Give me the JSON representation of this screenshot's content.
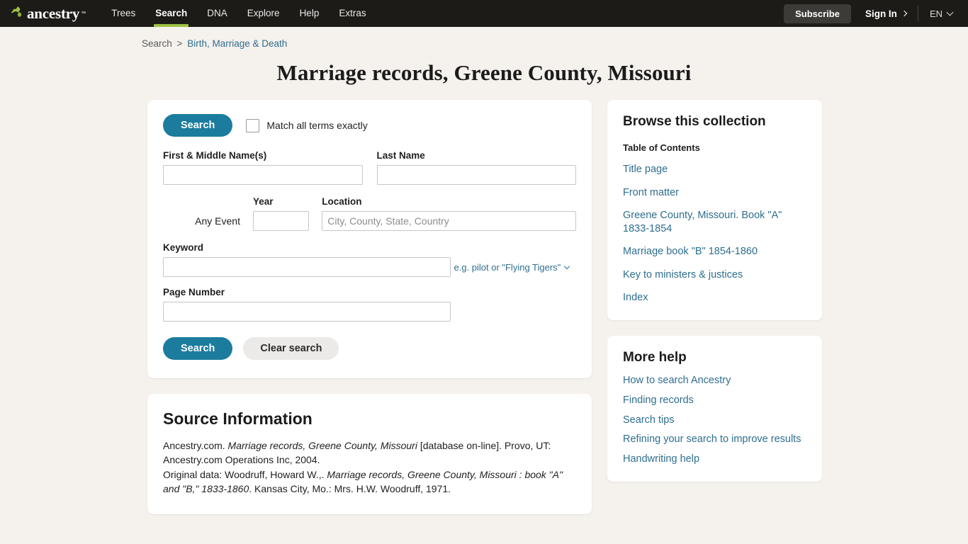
{
  "navbar": {
    "logo_text": "ancestry",
    "logo_tm": "™",
    "links": [
      {
        "label": "Trees",
        "active": false
      },
      {
        "label": "Search",
        "active": true
      },
      {
        "label": "DNA",
        "active": false
      },
      {
        "label": "Explore",
        "active": false
      },
      {
        "label": "Help",
        "active": false
      },
      {
        "label": "Extras",
        "active": false
      }
    ],
    "subscribe_label": "Subscribe",
    "signin_label": "Sign In",
    "language_label": "EN",
    "accent_green": "#9fc244",
    "bar_color": "#1c1b18"
  },
  "breadcrumb": {
    "root_label": "Search",
    "separator": ">",
    "current_label": "Birth, Marriage & Death"
  },
  "page": {
    "title": "Marriage records, Greene County, Missouri",
    "background": "#f5f1ed",
    "link_color": "#2e6e8e",
    "primary_button_color": "#1b7c9e"
  },
  "search_form": {
    "search_label_top": "Search",
    "match_exactly_label": "Match all terms exactly",
    "match_exactly_checked": false,
    "first_name": {
      "label": "First & Middle Name(s)",
      "value": "",
      "placeholder": ""
    },
    "last_name": {
      "label": "Last Name",
      "value": "",
      "placeholder": ""
    },
    "event": {
      "name_label": "Any Event",
      "year_label": "Year",
      "location_label": "Location",
      "year_value": "",
      "location_value": "",
      "location_placeholder": "City, County, State, Country"
    },
    "keyword": {
      "label": "Keyword",
      "value": "",
      "hint": "e.g. pilot or \"Flying Tigers\""
    },
    "page_number": {
      "label": "Page Number",
      "value": ""
    },
    "search_button_label": "Search",
    "clear_button_label": "Clear search"
  },
  "source_information": {
    "title": "Source Information",
    "line1_pre": "Ancestry.com. ",
    "line1_italic": "Marriage records, Greene County, Missouri",
    "line1_post": " [database on-line]. Provo, UT: Ancestry.com Operations Inc, 2004.",
    "line2_pre": "Original data: Woodruff, Howard W.,. ",
    "line2_italic": "Marriage records, Greene County, Missouri : book \"A\" and \"B,\" 1833-1860",
    "line2_post": ". Kansas City, Mo.: Mrs. H.W. Woodruff, 1971."
  },
  "browse_collection": {
    "title": "Browse this collection",
    "toc_heading": "Table of Contents",
    "items": [
      {
        "label": "Title page"
      },
      {
        "label": "Front matter"
      },
      {
        "label": "Greene County, Missouri. Book \"A\" 1833-1854"
      },
      {
        "label": "Marriage book \"B\" 1854-1860"
      },
      {
        "label": "Key to ministers & justices"
      },
      {
        "label": "Index"
      }
    ]
  },
  "more_help": {
    "title": "More help",
    "items": [
      {
        "label": "How to search Ancestry"
      },
      {
        "label": "Finding records"
      },
      {
        "label": "Search tips"
      },
      {
        "label": "Refining your search to improve results"
      },
      {
        "label": "Handwriting help"
      }
    ]
  }
}
